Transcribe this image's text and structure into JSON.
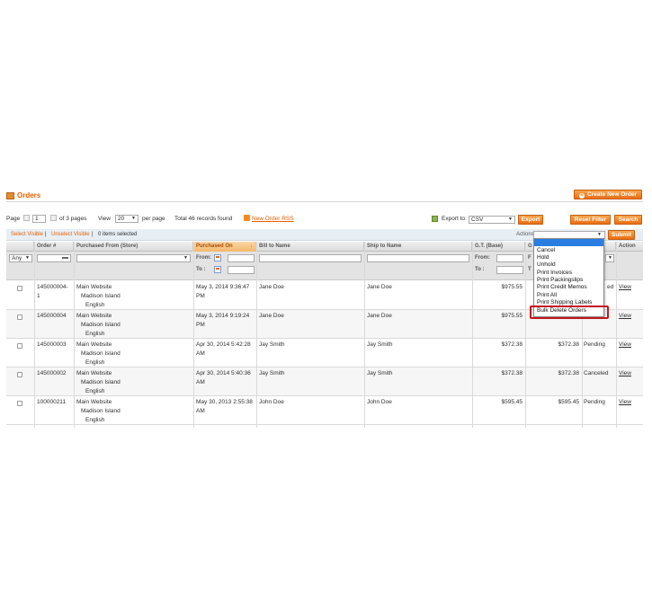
{
  "page": {
    "title": "Orders",
    "create_button": "Create New Order"
  },
  "pager": {
    "page_label": "Page",
    "page_value": "1",
    "of_pages": "of 3 pages",
    "view_label": "View",
    "per_page_value": "20",
    "per_page_label": "per page",
    "total": "Total 46 records found",
    "rss_link": "New Order RSS",
    "export_label": "Export to:",
    "export_format": "CSV",
    "export_button": "Export",
    "reset_button": "Reset Filter",
    "search_button": "Search"
  },
  "massaction": {
    "select_visible": "Select Visible",
    "unselect_visible": "Unselect Visible",
    "separator": "|",
    "selected_count": "0 items selected",
    "actions_label": "Actions",
    "submit_button": "Submit"
  },
  "columns": {
    "order": "Order #",
    "purchased_from": "Purchased From (Store)",
    "purchased_on": "Purchased On",
    "bill_to": "Bill to Name",
    "ship_to": "Ship to Name",
    "gt_base": "G.T. (Base)",
    "gt_purchased_partial": "G",
    "action": "Action"
  },
  "filters": {
    "any": "Any",
    "from": "From:",
    "to": "To :",
    "gt_from": "From:",
    "gt_to": "To :",
    "gp_from": "F",
    "gp_to": "T"
  },
  "actions_menu": [
    "Cancel",
    "Hold",
    "Unhold",
    "Print Invoices",
    "Print Packingslips",
    "Print Credit Memos",
    "Print All",
    "Print Shipping Labels",
    "Bulk Delete Orders"
  ],
  "rows": [
    {
      "order_line1": "145000004-",
      "order_line2": "1",
      "store1": "Main Website",
      "store2": "Madison Island",
      "store3": "English",
      "date1": "May 3, 2014 9:36:47",
      "date2": "PM",
      "bill": "Jane Doe",
      "ship": "Jane Doe",
      "gt_base": "$975.55",
      "gt_purchased": "",
      "status": "ed",
      "action": "View"
    },
    {
      "order_line1": "145000004",
      "order_line2": "",
      "store1": "Main Website",
      "store2": "Madison Island",
      "store3": "English",
      "date1": "May 3, 2014 9:19:24",
      "date2": "PM",
      "bill": "Jane Doe",
      "ship": "Jane Doe",
      "gt_base": "$975.55",
      "gt_purchased": "",
      "status": "",
      "action": "View"
    },
    {
      "order_line1": "145000003",
      "order_line2": "",
      "store1": "Main Website",
      "store2": "Madison Island",
      "store3": "English",
      "date1": "Apr 30, 2014 5:42:28",
      "date2": "AM",
      "bill": "Jay Smith",
      "ship": "Jay Smith",
      "gt_base": "$372.38",
      "gt_purchased": "$372.38",
      "status": "Pending",
      "action": "View"
    },
    {
      "order_line1": "145000002",
      "order_line2": "",
      "store1": "Main Website",
      "store2": "Madison Island",
      "store3": "English",
      "date1": "Apr 30, 2014 5:40:36",
      "date2": "AM",
      "bill": "Jay Smith",
      "ship": "Jay Smith",
      "gt_base": "$372.38",
      "gt_purchased": "$372.38",
      "status": "Canceled",
      "action": "View"
    },
    {
      "order_line1": "100000211",
      "order_line2": "",
      "store1": "Main Website",
      "store2": "Madison Island",
      "store3": "English",
      "date1": "May 30, 2013 2:55:38",
      "date2": "AM",
      "bill": "John Doe",
      "ship": "John Doe",
      "gt_base": "$595.45",
      "gt_purchased": "$595.45",
      "status": "Pending",
      "action": "View"
    }
  ],
  "icons": {
    "orders": "orders-icon",
    "calendar": "calendar-icon",
    "rss": "rss-icon",
    "export": "export-icon"
  },
  "colors": {
    "accent": "#eb5e00",
    "button": "#ea6e12",
    "highlight": "#c4161c",
    "dropdown_selected": "#2a7de1"
  }
}
